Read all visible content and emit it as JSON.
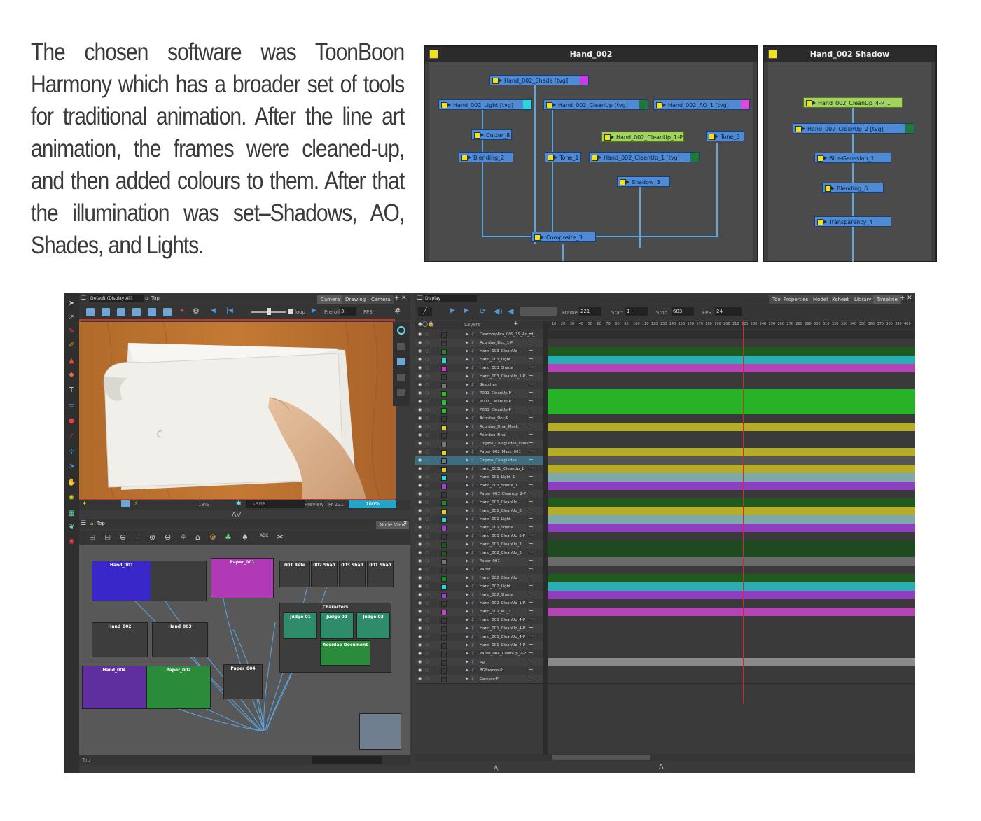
{
  "intro": {
    "text": "The chosen software was ToonBoon Harmony which has a broader set of tools for traditional animation. After the line art animation, the frames were cleaned-up, and then added colours to them. After that the illumination was set–Shadows, AO, Shades, and Lights."
  },
  "node_panel_1": {
    "title": "Hand_002",
    "nodes": [
      "Hand_002_Shade [tvg]",
      "Hand_002_Light [tvg]",
      "Hand_002_CleanUp [tvg]",
      "Hand_002_AO_1 [tvg]",
      "Cutter_8",
      "Hand_002_CleanUp_1-P",
      "Tone_3",
      "Blending_2",
      "Tone_1",
      "Hand_002_CleanUp_1 [tvg]",
      "Shadow_3",
      "Composite_3"
    ]
  },
  "node_panel_2": {
    "title": "Hand_002 Shadow",
    "nodes": [
      "Hand_002_CleanUp_4-P_1",
      "Hand_002_CleanUp_2 [tvg]",
      "Blur-Gaussian_1",
      "Blending_6",
      "Transparency_4"
    ]
  },
  "camera_view": {
    "display": "Default (Display All)",
    "breadcrumb": "Top",
    "tabs": [
      "Camera",
      "Drawing",
      "Camera"
    ],
    "loop": "loop",
    "preroll": "Preroll",
    "preroll_value": "3",
    "fps": "FPS",
    "zoom": "18%",
    "color_space": "sRGB",
    "preview": "Preview",
    "frame": "Fr 221",
    "progress_label": "100%",
    "progress_value": 1.0
  },
  "node_view": {
    "breadcrumb": "Top",
    "tab": "Node View",
    "status": "Top",
    "groups": [
      "Hand_001",
      "Paper_001",
      "001 Refe",
      "002 Shad",
      "003 Shad",
      "001 Shad",
      "Characters",
      "Judge 01",
      "Judge 02",
      "Judge 03",
      "Acordão Document",
      "Hand_002",
      "Hand_003",
      "Hand_004",
      "Paper_002",
      "Paper_004"
    ]
  },
  "timeline": {
    "display": "Display",
    "tabs": [
      "Tool Properties",
      "Model",
      "Xsheet",
      "Library",
      "Timeline"
    ],
    "frame_label": "Frame",
    "frame": "221",
    "start_label": "Start",
    "start": "1",
    "stop_label": "Stop",
    "stop": "603",
    "fps_label": "FPS",
    "fps": "24",
    "layers_label": "Layers",
    "ruler": [
      "10",
      "20",
      "30",
      "40",
      "50",
      "60",
      "70",
      "80",
      "90",
      "100",
      "110",
      "120",
      "130",
      "140",
      "150",
      "160",
      "170",
      "180",
      "190",
      "200",
      "210",
      "220",
      "230",
      "240",
      "250",
      "260",
      "270",
      "280",
      "290",
      "300",
      "310",
      "320",
      "330",
      "340",
      "350",
      "360",
      "370",
      "380",
      "390",
      "400"
    ],
    "layers": [
      {
        "name": "Descomplica_009_19_Ac_rd_",
        "color": "#3b3b3b",
        "track": "#2f2f2f"
      },
      {
        "name": "Acordao_Doc_1-P",
        "color": "#3b3b3b",
        "track": "#3a3a3a"
      },
      {
        "name": "Hand_003_CleanUp",
        "color": "#228b22",
        "track": "#1f5a1f"
      },
      {
        "name": "Hand_003_Light",
        "color": "#2dd6d6",
        "track": "#2aaeb4"
      },
      {
        "name": "Hand_003_Shade",
        "color": "#d23cd2",
        "track": "#b444b4"
      },
      {
        "name": "Hand_003_CleanUp_1-P",
        "color": "#3b3b3b",
        "track": "#3a3a3a"
      },
      {
        "name": "Sketches",
        "color": "#777777",
        "track": "#3a3a3a"
      },
      {
        "name": "P001_CleanUp-P",
        "color": "#22c922",
        "track": "#27b327"
      },
      {
        "name": "P002_CleanUp-P",
        "color": "#22c922",
        "track": "#27b327"
      },
      {
        "name": "P003_CleanUp-P",
        "color": "#22c922",
        "track": "#27b327"
      },
      {
        "name": "Acordao_Doc-P",
        "color": "#3b3b3b",
        "track": "#3a3a3a"
      },
      {
        "name": "Acordao_Final_Mask",
        "color": "#e0d21e",
        "track": "#b5ad2a"
      },
      {
        "name": "Acordao_Final",
        "color": "#3b3b3b",
        "track": "#3a3a3a"
      },
      {
        "name": "Orgaos_Colegiados_Lines",
        "color": "#777777",
        "track": "#3a3a3a"
      },
      {
        "name": "Paper_002_Mask_001",
        "color": "#e0d21e",
        "track": "#b5ad2a"
      },
      {
        "name": "Orgaos_Colegiados",
        "color": "#777777",
        "track": "#555555"
      },
      {
        "name": "Hand_003b_CleanUp_1",
        "color": "#e0d21e",
        "track": "#b5ad2a"
      },
      {
        "name": "Hand_001_Light_1",
        "color": "#2dd6d6",
        "track": "#7fa9a9"
      },
      {
        "name": "Hand_003_Shade_1",
        "color": "#a63ce0",
        "track": "#8e3fc0"
      },
      {
        "name": "Paper_003_CleanUp_2-P",
        "color": "#3b3b3b",
        "track": "#3a3a3a"
      },
      {
        "name": "Hand_001_CleanUp",
        "color": "#228b22",
        "track": "#1f5a1f"
      },
      {
        "name": "Hand_001_CleanUp_3",
        "color": "#e0d21e",
        "track": "#b5ad2a"
      },
      {
        "name": "Hand_001_Light",
        "color": "#2dd6d6",
        "track": "#7fa9a9"
      },
      {
        "name": "Hand_001_Shade",
        "color": "#a63ce0",
        "track": "#8e3fc0"
      },
      {
        "name": "Hand_001_CleanUp_5-P",
        "color": "#3b3b3b",
        "track": "#3a3a3a"
      },
      {
        "name": "Hand_001_CleanUp_2",
        "color": "#1a5a1a",
        "track": "#1f4a1f"
      },
      {
        "name": "Hand_002_CleanUp_3",
        "color": "#1a5a1a",
        "track": "#1f4a1f"
      },
      {
        "name": "Paper_001",
        "color": "#777777",
        "track": "#6a6a6a"
      },
      {
        "name": "Paper1",
        "color": "#3b3b3b",
        "track": "#3a3a3a"
      },
      {
        "name": "Hand_002_CleanUp",
        "color": "#228b22",
        "track": "#1f5a1f"
      },
      {
        "name": "Hand_002_Light",
        "color": "#2dd6d6",
        "track": "#2aaeb4"
      },
      {
        "name": "Hand_002_Shade",
        "color": "#a63ce0",
        "track": "#8e3fc0"
      },
      {
        "name": "Hand_002_CleanUp_1-P",
        "color": "#3b3b3b",
        "track": "#3a3a3a"
      },
      {
        "name": "Hand_002_AO_1",
        "color": "#d23cd2",
        "track": "#b444b4"
      },
      {
        "name": "Hand_001_CleanUp_4-P",
        "color": "#3b3b3b",
        "track": "#3a3a3a"
      },
      {
        "name": "Hand_001_CleanUp_4-P",
        "color": "#3b3b3b",
        "track": "#3a3a3a"
      },
      {
        "name": "Hand_001_CleanUp_4-P",
        "color": "#3b3b3b",
        "track": "#3a3a3a"
      },
      {
        "name": "Hand_001_CleanUp_4-P",
        "color": "#3b3b3b",
        "track": "#3a3a3a"
      },
      {
        "name": "Paper_004_CleanUp_2-P",
        "color": "#3b3b3b",
        "track": "#3a3a3a"
      },
      {
        "name": "bg",
        "color": "#3b3b3b",
        "track": "#8a8a8a"
      },
      {
        "name": "BGBranco-P",
        "color": "#3b3b3b",
        "track": "#3a3a3a"
      },
      {
        "name": "Camera-P",
        "color": "#3b3b3b",
        "track": "#3a3a3a"
      }
    ]
  }
}
